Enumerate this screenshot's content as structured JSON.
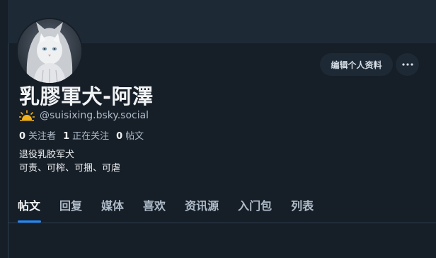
{
  "profile": {
    "display_name": "乳膠軍犬-阿澤",
    "handle": "@suisixing.bsky.social",
    "handle_icon": "sun-icon",
    "edit_label": "编辑个人资料",
    "more_label": "···"
  },
  "stats": [
    {
      "count": "0",
      "label": "关注者"
    },
    {
      "count": "1",
      "label": "正在关注"
    },
    {
      "count": "0",
      "label": "帖文"
    }
  ],
  "bio": {
    "line1": "退役乳胶军犬",
    "line2": "可责、可榨、可捆、可虐"
  },
  "tabs": [
    {
      "label": "帖文",
      "active": true
    },
    {
      "label": "回复"
    },
    {
      "label": "媒体"
    },
    {
      "label": "喜欢"
    },
    {
      "label": "资讯源"
    },
    {
      "label": "入门包"
    },
    {
      "label": "列表"
    }
  ],
  "colors": {
    "background": "#161e27",
    "banner": "#1e2936",
    "accent": "#208bfe",
    "muted_text": "#aebbc9"
  }
}
